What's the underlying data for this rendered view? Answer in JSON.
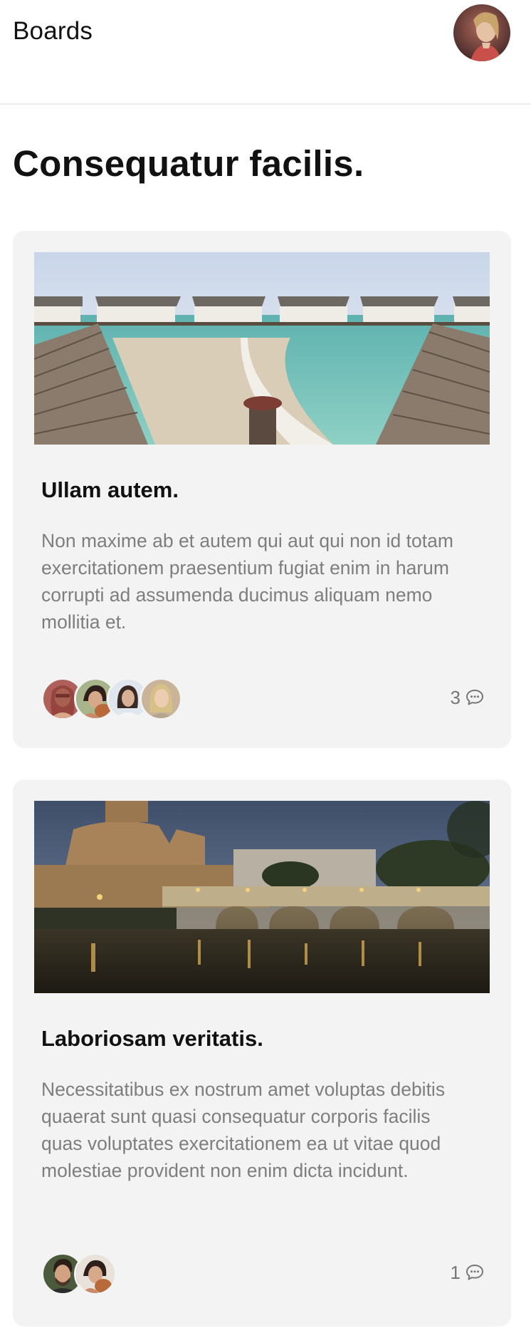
{
  "header": {
    "title": "Boards",
    "avatar_icon": "user-avatar"
  },
  "page": {
    "title": "Consequatur facilis."
  },
  "cards": [
    {
      "image_icon": "beach-overwater-bungalows-photo",
      "title": "Ullam autem.",
      "description": "Non maxime ab et autem qui aut qui non id totam exercitationem praesentium fugiat enim in harum corrupti ad assumenda ducimus aliquam nemo mollitia et.",
      "member_count": 4,
      "comments": "3",
      "comment_icon": "speech-bubble-icon"
    },
    {
      "image_icon": "castle-bridge-river-night-photo",
      "title": "Laboriosam veritatis.",
      "description": "Necessitatibus ex nostrum amet voluptas debitis quaerat sunt quasi consequatur corporis facilis quas voluptates exercitationem ea ut vitae quod molestiae provident non enim dicta incidunt.",
      "member_count": 2,
      "comments": "1",
      "comment_icon": "speech-bubble-icon"
    }
  ]
}
